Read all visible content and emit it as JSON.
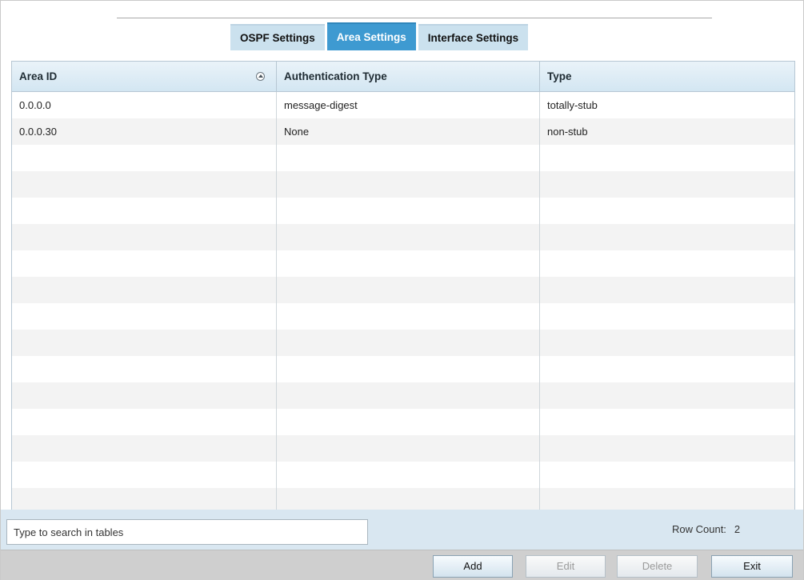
{
  "tabs": [
    {
      "label": "OSPF Settings",
      "active": false
    },
    {
      "label": "Area Settings",
      "active": true
    },
    {
      "label": "Interface Settings",
      "active": false
    }
  ],
  "table": {
    "columns": [
      "Area ID",
      "Authentication Type",
      "Type"
    ],
    "rows": [
      [
        "0.0.0.0",
        "message-digest",
        "totally-stub"
      ],
      [
        "0.0.0.30",
        "None",
        "non-stub"
      ]
    ]
  },
  "search": {
    "placeholder": "Type to search in tables"
  },
  "row_count": {
    "label": "Row Count:",
    "value": "2"
  },
  "buttons": {
    "add": "Add",
    "edit": "Edit",
    "delete": "Delete",
    "exit": "Exit"
  },
  "colors": {
    "active_tab": "#3e9ad1",
    "inactive_tab": "#cbe1ee",
    "footer": "#d9e7f1"
  }
}
